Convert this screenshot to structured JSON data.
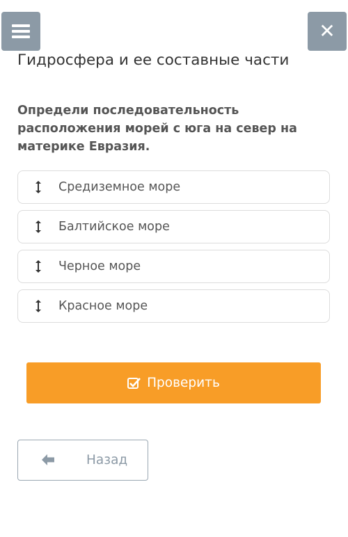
{
  "header": {
    "menu_icon": "hamburger-icon",
    "close_icon": "close-icon",
    "title": "Гидросфера и ее составные части"
  },
  "question": {
    "text": "Определи последовательность расположения морей с юга на север на материке Евразия."
  },
  "items": [
    {
      "label": "Средиземное море",
      "icon": "vertical-arrows-icon"
    },
    {
      "label": "Балтийское море",
      "icon": "vertical-arrows-icon"
    },
    {
      "label": "Черное море",
      "icon": "vertical-arrows-icon"
    },
    {
      "label": "Красное море",
      "icon": "vertical-arrows-icon"
    }
  ],
  "actions": {
    "check_label": "Проверить",
    "check_icon": "checkbox-checked-icon",
    "back_label": "Назад",
    "back_icon": "arrow-left-icon"
  },
  "colors": {
    "header_buttons": "#8c9aa6",
    "check_button": "#f89d27",
    "text": "#333333"
  }
}
